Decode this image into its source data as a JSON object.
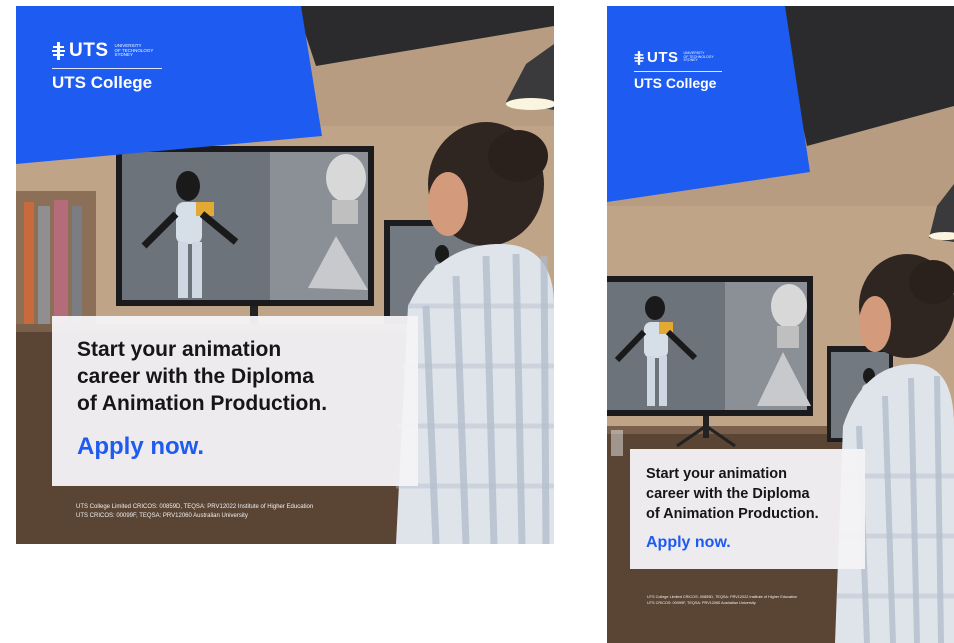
{
  "colors": {
    "brand_blue": "#1e5bf0",
    "dark_band": "#2b2b2d",
    "wall": "#b79c81",
    "desk": "#5a4434",
    "cta_blue": "#1e5bf0"
  },
  "ads": [
    {
      "variant": "square",
      "logo": {
        "wordmark": "UTS",
        "tagline": [
          "UNIVERSITY",
          "OF TECHNOLOGY",
          "SYDNEY"
        ],
        "college": "UTS College"
      },
      "headline": [
        "Start your animation",
        "career with the Diploma",
        "of Animation Production."
      ],
      "cta": "Apply now.",
      "legal": [
        "UTS College Limited CRICOS: 00859D, TEQSA: PRV12022 Institute of Higher Education",
        "UTS CRICOS: 00099F, TEQSA: PRV12060 Australian University"
      ]
    },
    {
      "variant": "portrait",
      "logo": {
        "wordmark": "UTS",
        "tagline": [
          "UNIVERSITY",
          "OF TECHNOLOGY",
          "SYDNEY"
        ],
        "college": "UTS College"
      },
      "headline": [
        "Start your animation",
        "career with the Diploma",
        "of Animation Production."
      ],
      "cta": "Apply now.",
      "legal": [
        "UTS College Limited CRICOS: 00859D, TEQSA: PRV12022 Institute of Higher Education",
        "UTS CRICOS: 00099F, TEQSA: PRV12060 Australian University"
      ]
    }
  ]
}
